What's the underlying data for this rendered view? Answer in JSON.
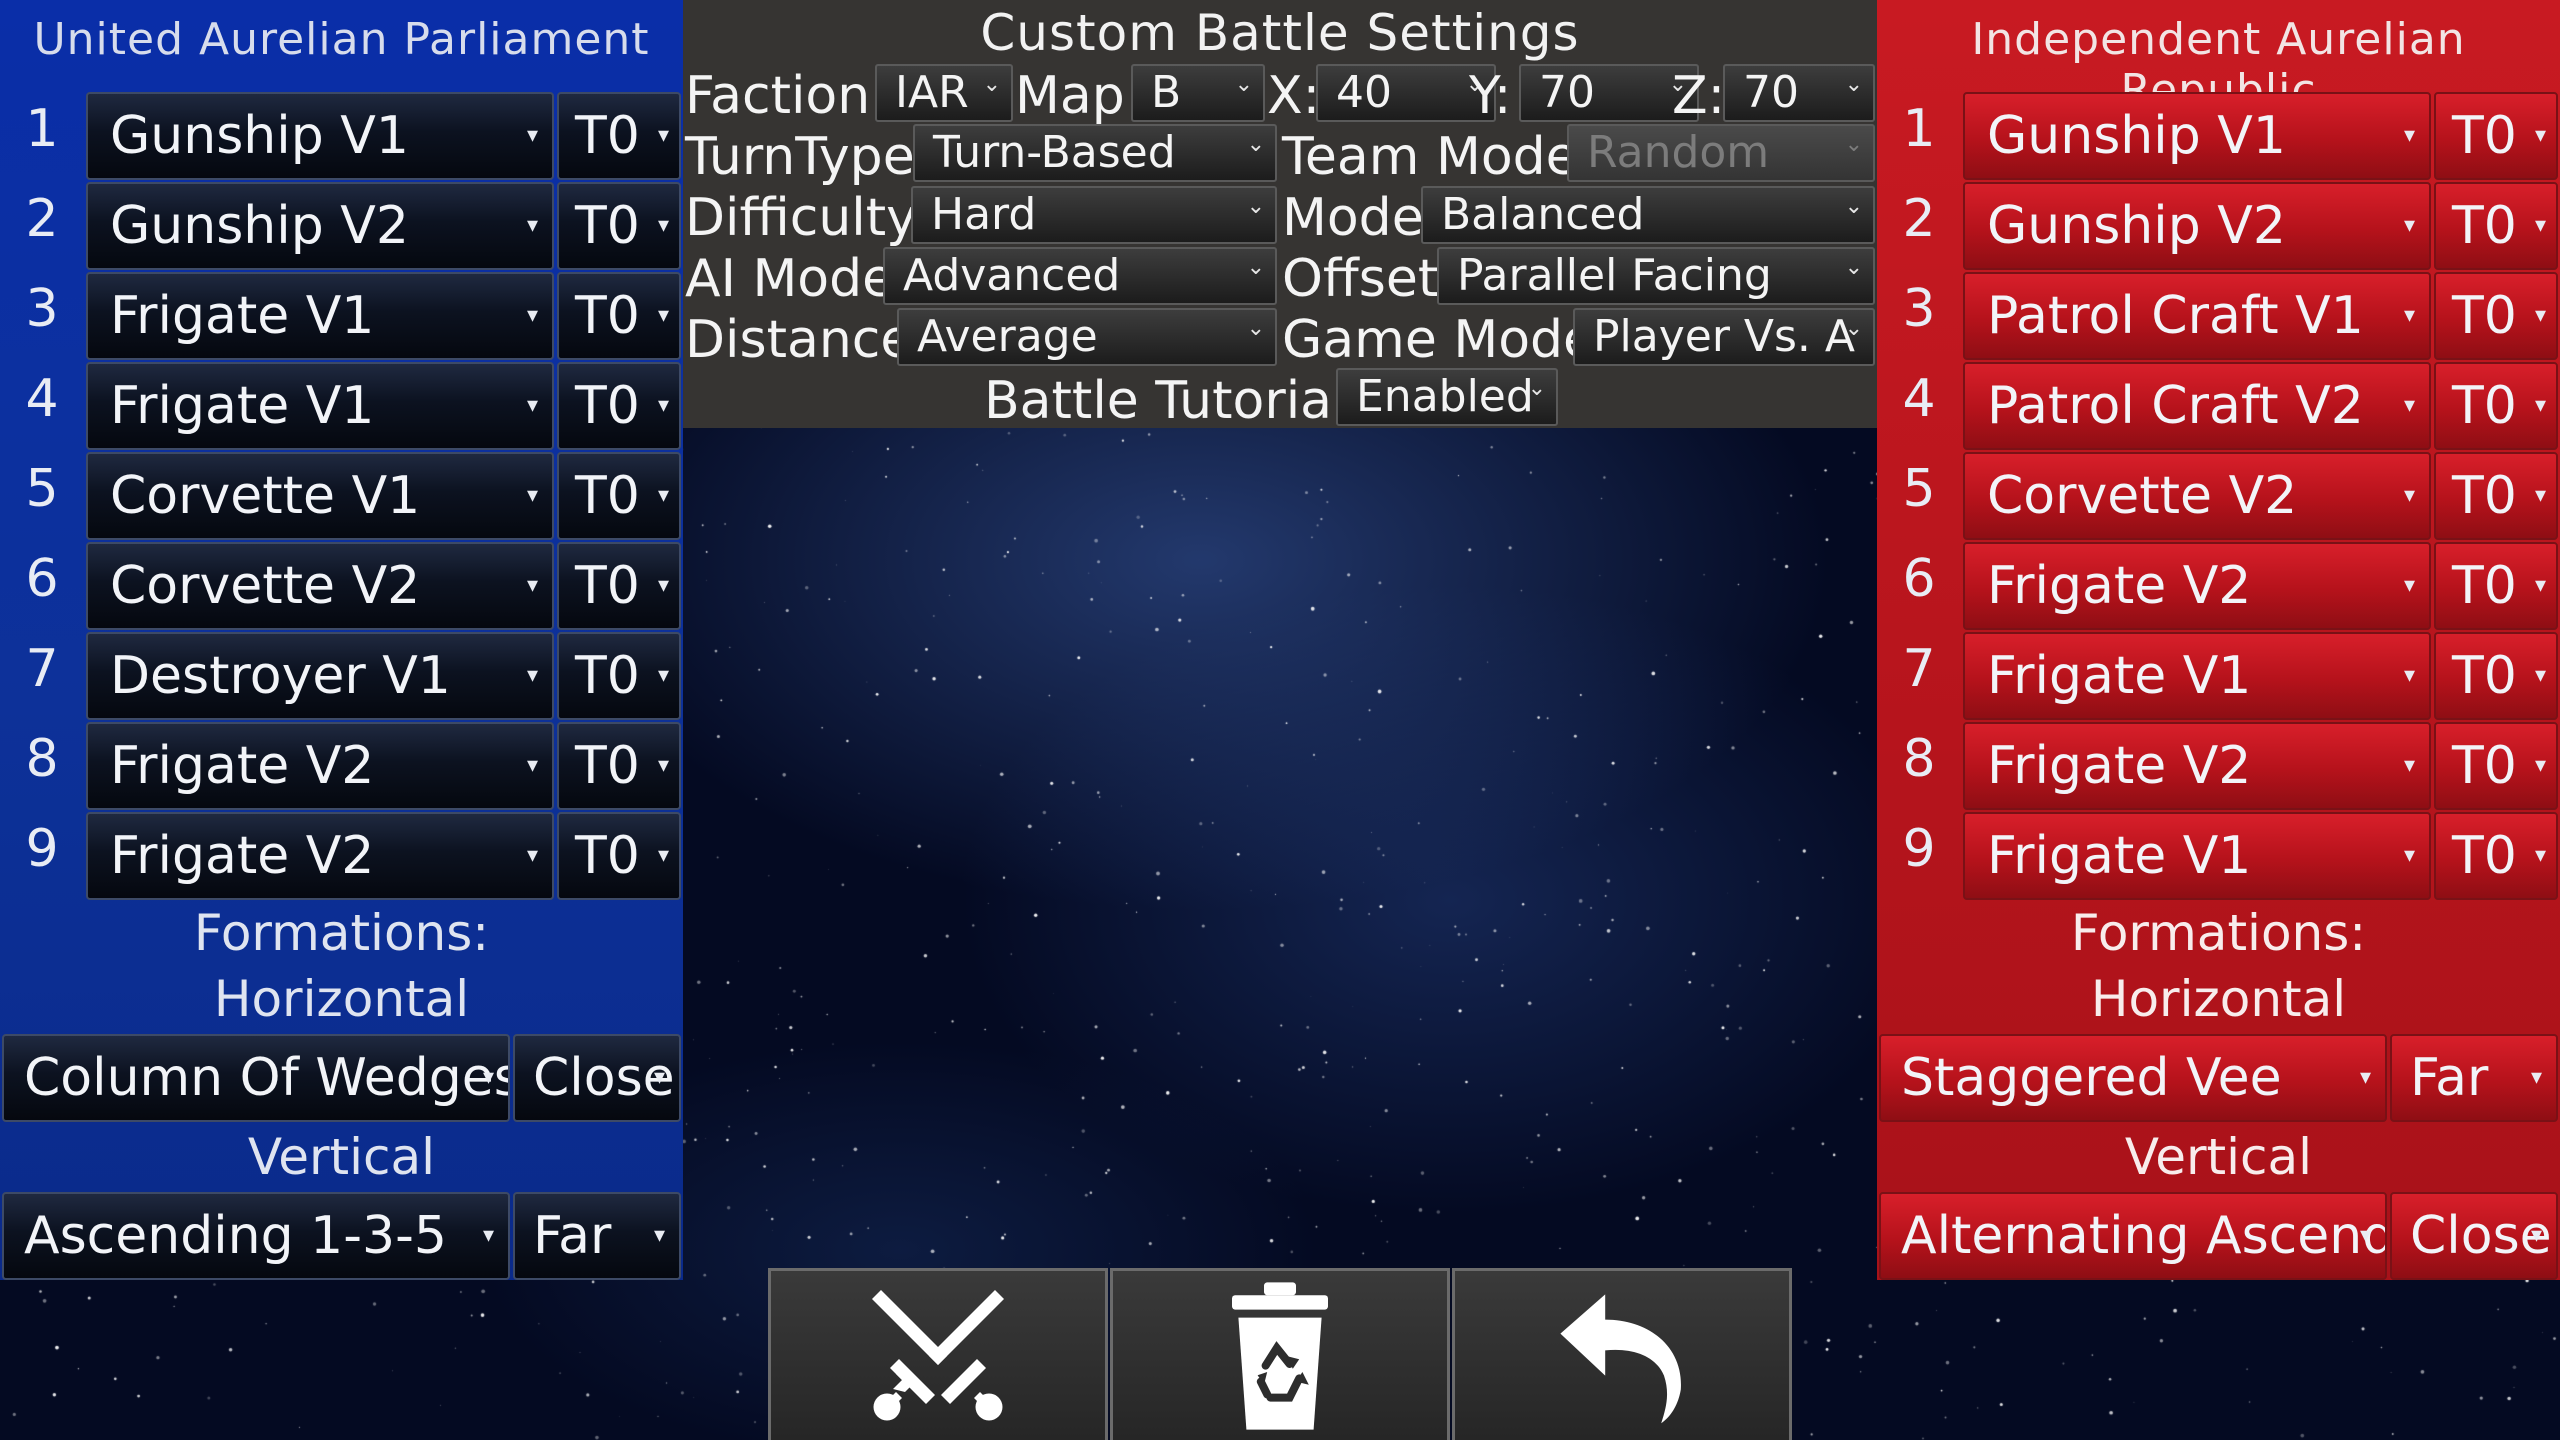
{
  "settings": {
    "title": "Custom Battle Settings",
    "faction": {
      "label": "Faction",
      "value": "IAR"
    },
    "map": {
      "label": "Map",
      "value": "B"
    },
    "x": {
      "label": "X:",
      "value": "40"
    },
    "y": {
      "label": "Y:",
      "value": "70"
    },
    "z": {
      "label": "Z:",
      "value": "70"
    },
    "turn_type": {
      "label": "TurnType",
      "value": "Turn-Based"
    },
    "team_mode": {
      "label": "Team Mode",
      "value": "Random"
    },
    "difficulty": {
      "label": "Difficulty",
      "value": "Hard"
    },
    "mode": {
      "label": "Mode",
      "value": "Balanced"
    },
    "ai_mode": {
      "label": "AI Mode",
      "value": "Advanced"
    },
    "offset": {
      "label": "Offset",
      "value": "Parallel Facing"
    },
    "distance": {
      "label": "Distance",
      "value": "Average"
    },
    "game_mode": {
      "label": "Game Mode",
      "value": "Player Vs. A"
    },
    "battle_tutorial": {
      "label": "Battle Tutorial",
      "value": "Enabled"
    }
  },
  "left": {
    "title": "United Aurelian Parliament",
    "color": "#0a2ea8",
    "slots": [
      {
        "num": "1",
        "ship": "Gunship V1",
        "team": "T0"
      },
      {
        "num": "2",
        "ship": "Gunship V2",
        "team": "T0"
      },
      {
        "num": "3",
        "ship": "Frigate V1",
        "team": "T0"
      },
      {
        "num": "4",
        "ship": "Frigate V1",
        "team": "T0"
      },
      {
        "num": "5",
        "ship": "Corvette V1",
        "team": "T0"
      },
      {
        "num": "6",
        "ship": "Corvette V2",
        "team": "T0"
      },
      {
        "num": "7",
        "ship": "Destroyer V1",
        "team": "T0"
      },
      {
        "num": "8",
        "ship": "Frigate V2",
        "team": "T0"
      },
      {
        "num": "9",
        "ship": "Frigate V2",
        "team": "T0"
      }
    ],
    "formations_label_1": "Formations:",
    "formations_label_2": "Horizontal",
    "horizontal_formation": "Column Of Wedges",
    "horizontal_spacing": "Close",
    "vertical_label": "Vertical",
    "vertical_formation": "Ascending 1-3-5",
    "vertical_spacing": "Far"
  },
  "right": {
    "title": "Independent Aurelian Republic",
    "color": "#c81a22",
    "slots": [
      {
        "num": "1",
        "ship": "Gunship V1",
        "team": "T0"
      },
      {
        "num": "2",
        "ship": "Gunship V2",
        "team": "T0"
      },
      {
        "num": "3",
        "ship": "Patrol Craft V1",
        "team": "T0"
      },
      {
        "num": "4",
        "ship": "Patrol Craft V2",
        "team": "T0"
      },
      {
        "num": "5",
        "ship": "Corvette V2",
        "team": "T0"
      },
      {
        "num": "6",
        "ship": "Frigate V2",
        "team": "T0"
      },
      {
        "num": "7",
        "ship": "Frigate V1",
        "team": "T0"
      },
      {
        "num": "8",
        "ship": "Frigate V2",
        "team": "T0"
      },
      {
        "num": "9",
        "ship": "Frigate V1",
        "team": "T0"
      }
    ],
    "formations_label_1": "Formations:",
    "formations_label_2": "Horizontal",
    "horizontal_formation": "Staggered Vee",
    "horizontal_spacing": "Far",
    "vertical_label": "Vertical",
    "vertical_formation": "Alternating Ascending",
    "vertical_spacing": "Close"
  },
  "buttons": {
    "start_icon": "crossed-swords-icon",
    "clear_icon": "recycle-bin-icon",
    "back_icon": "undo-arrow-icon"
  }
}
